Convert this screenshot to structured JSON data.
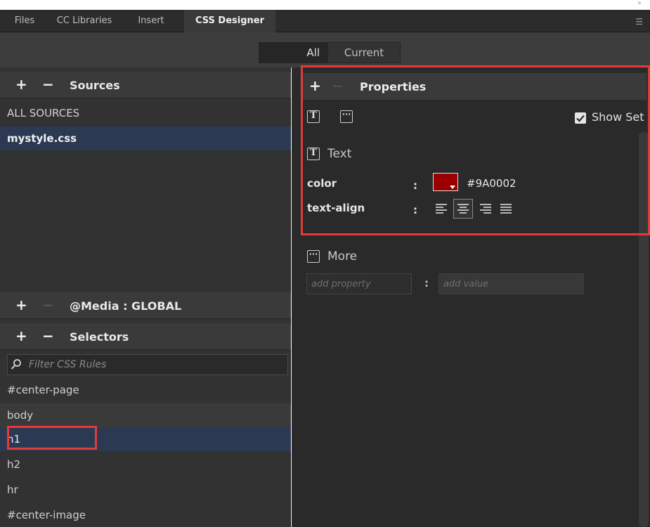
{
  "tabs": [
    {
      "label": "Files",
      "active": false
    },
    {
      "label": "CC Libraries",
      "active": false
    },
    {
      "label": "Insert",
      "active": false
    },
    {
      "label": "CSS Designer",
      "active": true
    }
  ],
  "view_toggle": {
    "all_label": "All",
    "current_label": "Current",
    "selected": "All"
  },
  "sources": {
    "title": "Sources",
    "items": [
      {
        "label": "ALL SOURCES",
        "selected": false
      },
      {
        "label": "mystyle.css",
        "selected": true
      }
    ]
  },
  "media": {
    "title": "@Media : GLOBAL"
  },
  "selectors": {
    "title": "Selectors",
    "filter_placeholder": "Filter CSS Rules",
    "items": [
      {
        "label": "#center-page",
        "selected": false
      },
      {
        "label": "body",
        "selected": false
      },
      {
        "label": "h1",
        "selected": true
      },
      {
        "label": "h2",
        "selected": false
      },
      {
        "label": "hr",
        "selected": false
      },
      {
        "label": "#center-image",
        "selected": false
      }
    ]
  },
  "properties": {
    "title": "Properties",
    "show_set_label": "Show Set",
    "show_set_checked": true,
    "text_section_label": "Text",
    "color": {
      "name": "color",
      "colon": ":",
      "value": "#9A0002",
      "swatch": "#9A0002"
    },
    "text_align": {
      "name": "text-align",
      "colon": ":",
      "options": [
        "left",
        "center",
        "right",
        "justify"
      ],
      "selected": "center"
    },
    "more_label": "More",
    "add_property_placeholder": "add property",
    "add_value_placeholder": "add value",
    "add_colon": ":"
  },
  "colors": {
    "highlight": "#e53a3a",
    "selection_row": "#2b3a52",
    "panel_bg": "#323232"
  },
  "icons": {
    "plus": "+",
    "minus": "−",
    "filter": "search-icon",
    "text": "T",
    "more": "···"
  }
}
